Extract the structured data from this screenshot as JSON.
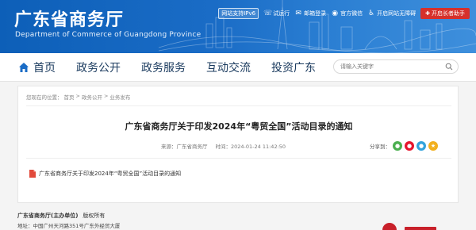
{
  "header": {
    "site_title": "广东省商务厅",
    "site_subtitle": "Department of Commerce of Guangdong Province",
    "ipv6_badge": "网站支持IPv6",
    "topbar": [
      {
        "label": "试运行",
        "icon": "phone-icon"
      },
      {
        "label": "邮箱登录",
        "icon": "mail-icon"
      },
      {
        "label": "官方微信",
        "icon": "wechat-icon"
      },
      {
        "label": "开启网站无障碍",
        "icon": "accessibility-icon"
      }
    ],
    "elder_button": "开启长者助手"
  },
  "nav": {
    "items": [
      "首页",
      "政务公开",
      "政务服务",
      "互动交流",
      "投资广东"
    ],
    "search_placeholder": "请输入关键字"
  },
  "breadcrumb": {
    "prefix": "您现在的位置：",
    "items": [
      "首页",
      "政务公开",
      "业务发布"
    ],
    "separator": ">"
  },
  "article": {
    "title": "广东省商务厅关于印发2024年“粤贸全国”活动目录的通知",
    "source_label": "来源：广东省商务厅",
    "time_label": "时间：2024-01-24 11:42:50",
    "share_label": "分享到：",
    "share_icons": [
      {
        "name": "wechat",
        "color": "#4caf50"
      },
      {
        "name": "weibo",
        "color": "#e6162d"
      },
      {
        "name": "qzone",
        "color": "#33a3dc"
      },
      {
        "name": "star",
        "color": "#f2b01e"
      }
    ],
    "attachment": "广东省商务厅关于印发2024年“粤贸全国”活动目录的通知"
  },
  "footer": {
    "org": "广东省商务厅(主办单位)",
    "rights": "版权所有",
    "address": "地址：中国广州天河路351号广东外经贸大厦"
  },
  "colors": {
    "header_blue": "#1a6cc6",
    "nav_text": "#1a3a5e",
    "elder_red": "#d6302b"
  }
}
